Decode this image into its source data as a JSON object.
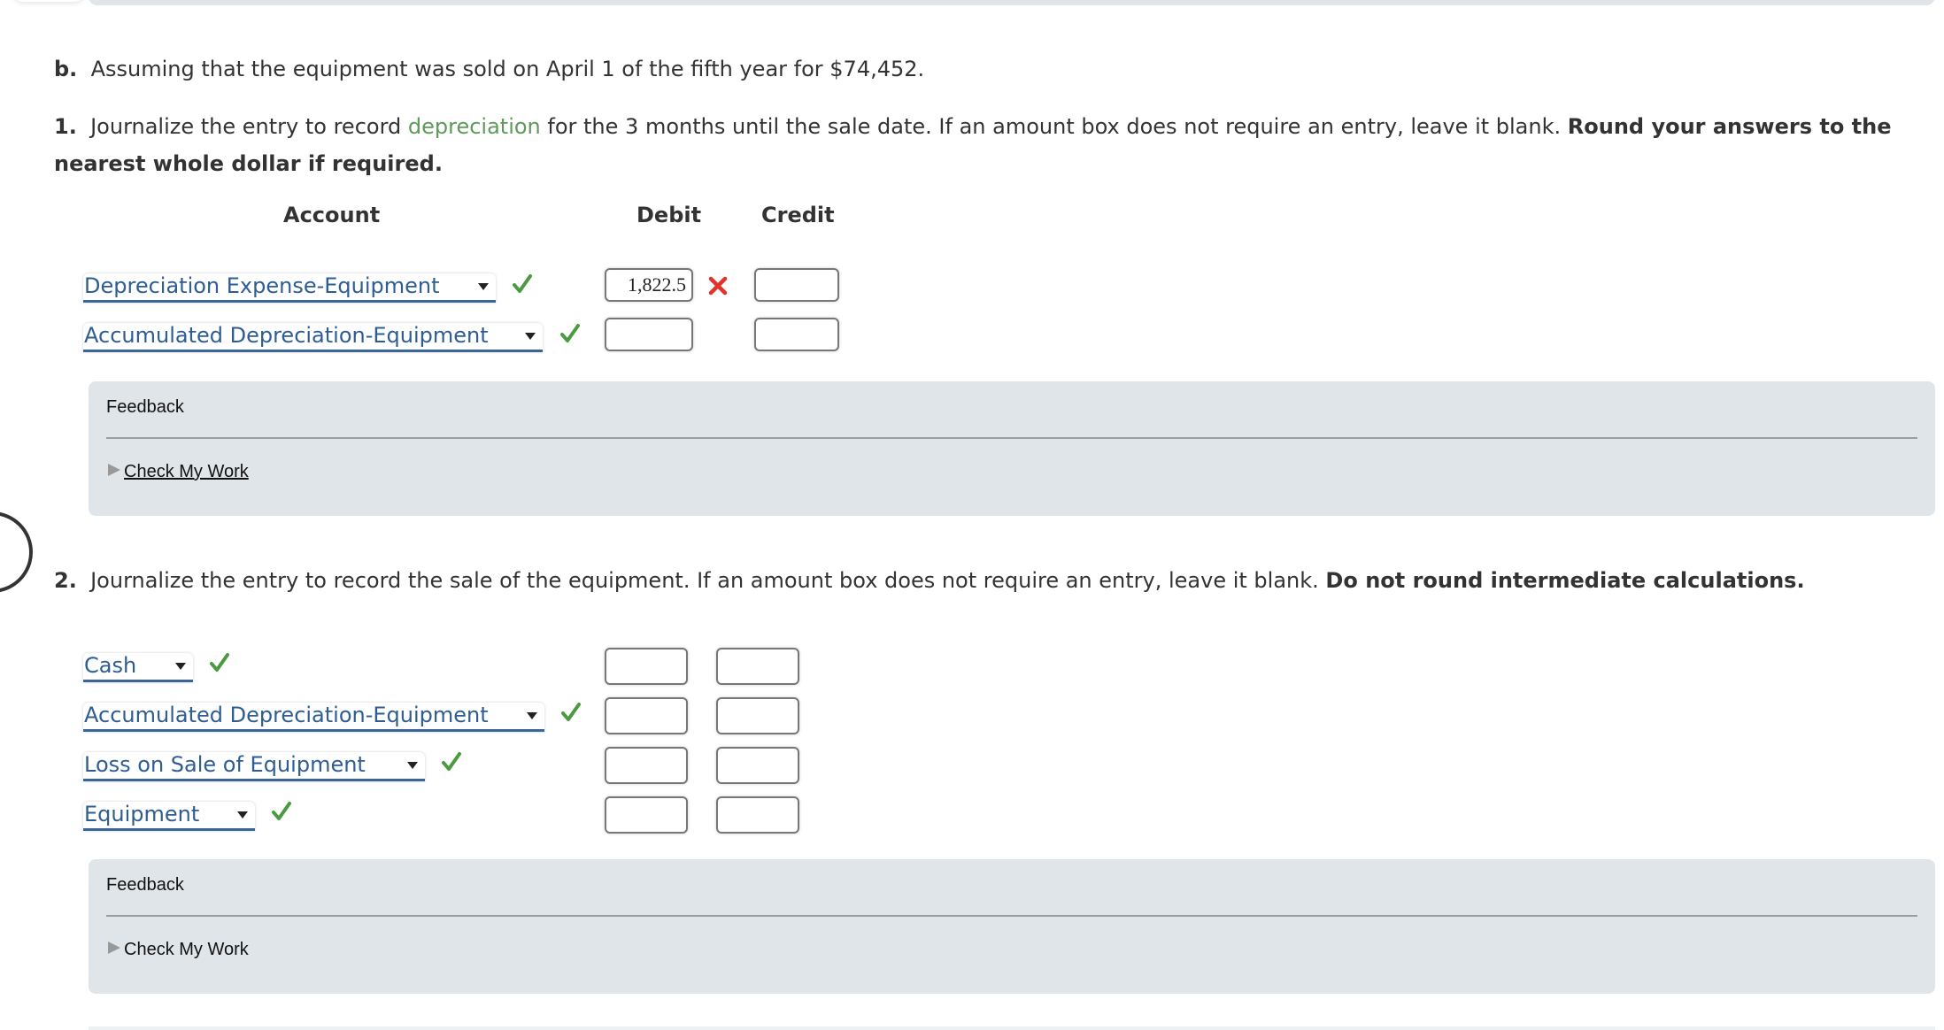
{
  "part_b": {
    "label": "b.",
    "text": "Assuming that the equipment was sold on April 1 of the fifth year for $74,452."
  },
  "q1": {
    "number": "1.",
    "text_before": "Journalize the entry to record ",
    "glossary_term": "depreciation",
    "text_after": " for the 3 months until the sale date. If an amount box does not require an entry, leave it blank. ",
    "bold_line1": "Round your answers to the",
    "bold_line2": "nearest whole dollar if required.",
    "headers": {
      "account": "Account",
      "debit": "Debit",
      "credit": "Credit"
    },
    "rows": [
      {
        "account": "Depreciation Expense-Equipment",
        "account_status": "correct",
        "debit": "1,822.5",
        "debit_status": "incorrect",
        "credit": ""
      },
      {
        "account": "Accumulated Depreciation-Equipment",
        "account_status": "correct",
        "debit": "",
        "credit": ""
      }
    ],
    "feedback": {
      "title": "Feedback",
      "check_label": "Check My Work"
    }
  },
  "q2": {
    "number": "2.",
    "text": "Journalize the entry to record the sale of the equipment. If an amount box does not require an entry, leave it blank. ",
    "bold": "Do not round intermediate calculations.",
    "rows": [
      {
        "account": "Cash",
        "account_status": "correct",
        "debit": "",
        "credit": ""
      },
      {
        "account": "Accumulated Depreciation-Equipment",
        "account_status": "correct",
        "debit": "",
        "credit": ""
      },
      {
        "account": "Loss on Sale of Equipment",
        "account_status": "correct",
        "debit": "",
        "credit": ""
      },
      {
        "account": "Equipment",
        "account_status": "correct",
        "debit": "",
        "credit": ""
      }
    ],
    "feedback": {
      "title": "Feedback",
      "check_label": "Check My Work"
    }
  },
  "colors": {
    "correct": "#4a9a3f",
    "incorrect": "#e2322d",
    "glossary": "#5f9a5a",
    "select_text": "#2e5d94"
  }
}
